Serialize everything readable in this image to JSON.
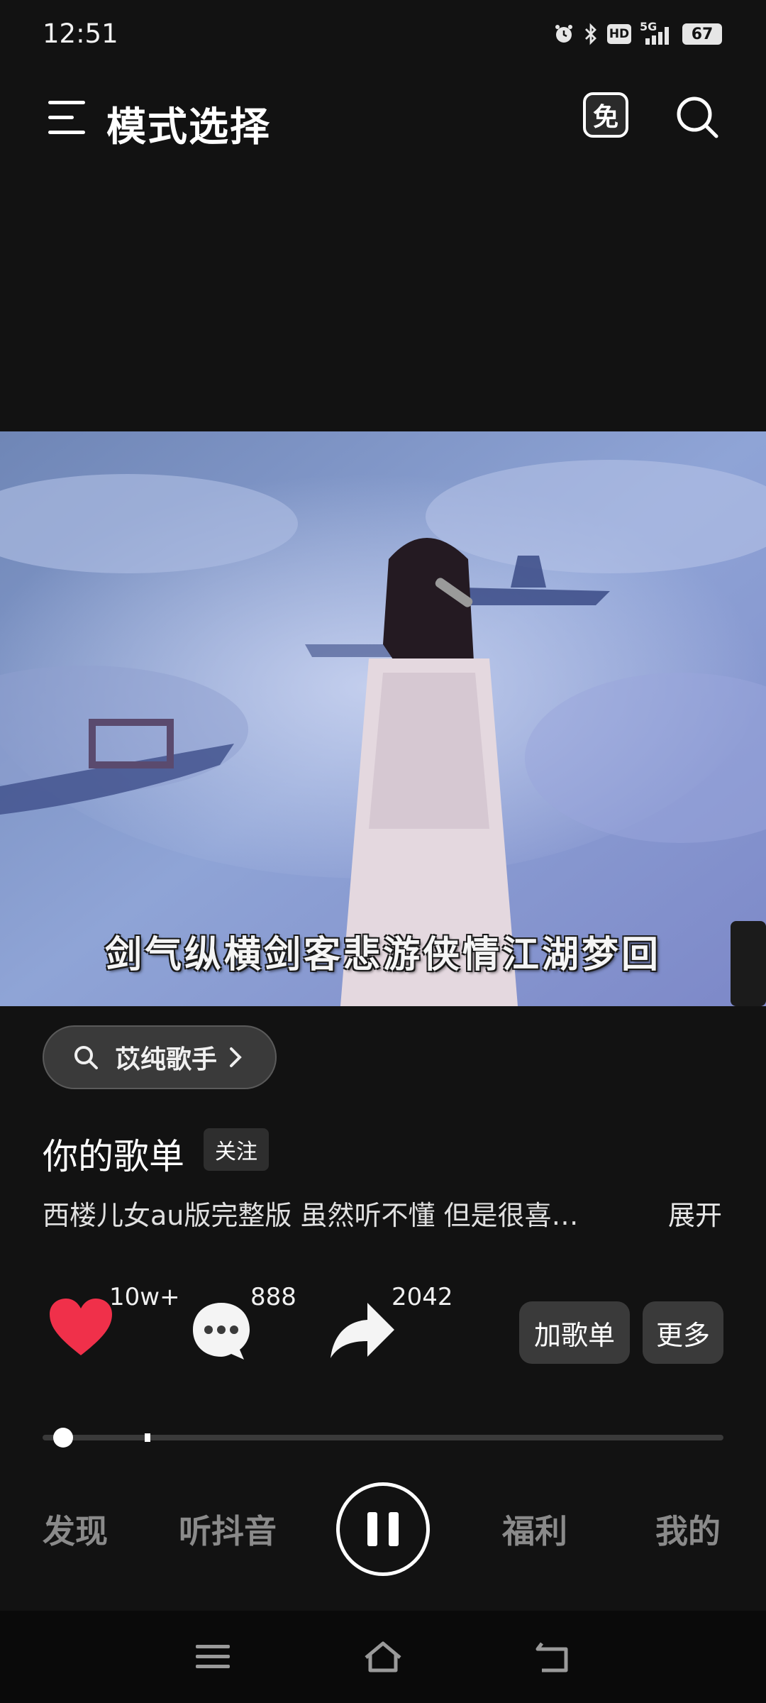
{
  "status_bar": {
    "time": "12:51",
    "icons": [
      "alarm-icon",
      "bluetooth-icon",
      "hd-icon",
      "5g-signal-icon"
    ],
    "hd_label": "HD",
    "network_label": "5G",
    "battery": "67"
  },
  "app_bar": {
    "title": "模式选择",
    "menu_icon": "menu-icon",
    "free_icon_label": "免",
    "search_icon": "search-icon"
  },
  "video": {
    "subtitle": "剑气纵横剑客悲游侠情江湖梦回"
  },
  "search_chip": {
    "text": "苡纯歌手"
  },
  "playlist": {
    "title": "你的歌单",
    "follow_label": "关注",
    "description": "西楼儿女au版完整版 虽然听不懂 但是很喜…",
    "expand_label": "展开"
  },
  "actions": {
    "like_count": "10w+",
    "comment_count": "888",
    "share_count": "2042",
    "add_to_playlist_label": "加歌单",
    "more_label": "更多"
  },
  "progress": {
    "fraction": 0.03
  },
  "bottom_nav": {
    "items": [
      {
        "label": "发现"
      },
      {
        "label": "听抖音"
      },
      {
        "label": "福利"
      },
      {
        "label": "我的"
      }
    ]
  },
  "colors": {
    "background": "#121212",
    "like_red": "#f0304a",
    "chip_bg": "#3a3a3a"
  }
}
